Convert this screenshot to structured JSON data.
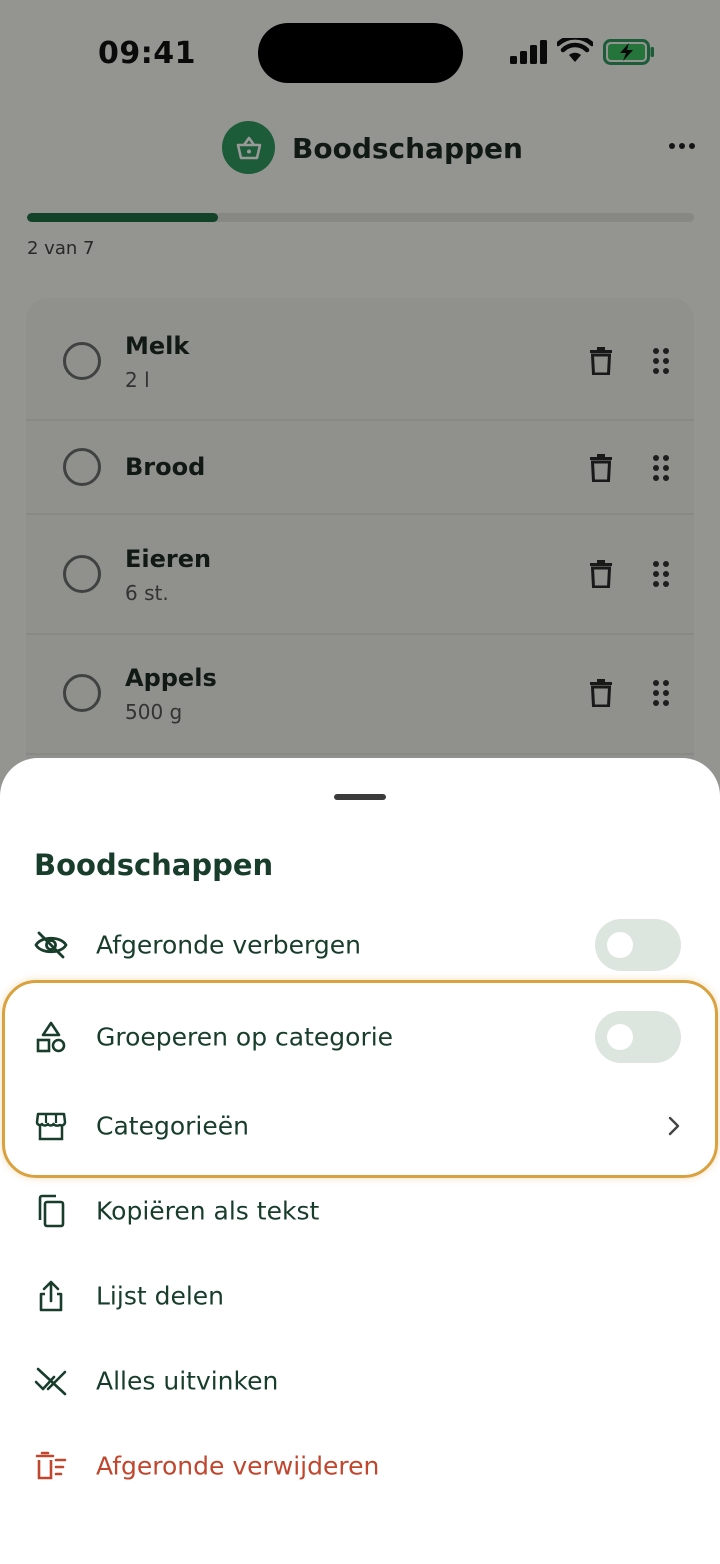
{
  "status_bar": {
    "time": "09:41"
  },
  "header": {
    "title": "Boodschappen"
  },
  "progress": {
    "label": "2 van 7",
    "fraction": 0.2857
  },
  "list": {
    "items": [
      {
        "name": "Melk",
        "quantity": "2 l"
      },
      {
        "name": "Brood",
        "quantity": ""
      },
      {
        "name": "Eieren",
        "quantity": "6 st."
      },
      {
        "name": "Appels",
        "quantity": "500 g"
      }
    ]
  },
  "sheet": {
    "title": "Boodschappen",
    "hide_completed": {
      "label": "Afgeronde verbergen",
      "enabled": false
    },
    "group_by_category": {
      "label": "Groeperen op categorie",
      "enabled": false
    },
    "categories": {
      "label": "Categorieën"
    },
    "copy_as_text": {
      "label": "Kopiëren als tekst"
    },
    "share_list": {
      "label": "Lijst delen"
    },
    "uncheck_all": {
      "label": "Alles uitvinken"
    },
    "delete_completed": {
      "label": "Afgeronde verwijderen"
    }
  },
  "colors": {
    "brand_green": "#2f9a5e",
    "progress_green": "#1f6e44",
    "sheet_text": "#183d2b",
    "danger": "#c0472e",
    "highlight": "#d9a23e"
  }
}
